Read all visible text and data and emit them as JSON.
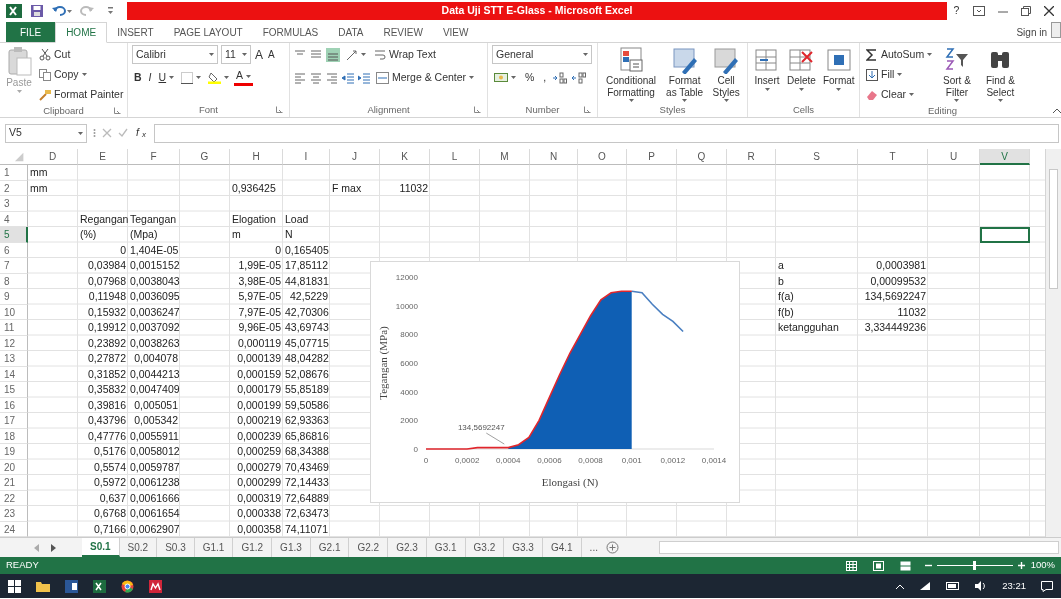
{
  "window": {
    "title": "Data Uji STT E-Glass  -  Microsoft Excel",
    "help": "?"
  },
  "ribbon_tabs": [
    {
      "label": "FILE",
      "kind": "file",
      "selected": false
    },
    {
      "label": "HOME",
      "kind": "tab",
      "selected": true
    },
    {
      "label": "INSERT",
      "kind": "tab",
      "selected": false
    },
    {
      "label": "PAGE LAYOUT",
      "kind": "tab",
      "selected": false
    },
    {
      "label": "FORMULAS",
      "kind": "tab",
      "selected": false
    },
    {
      "label": "DATA",
      "kind": "tab",
      "selected": false
    },
    {
      "label": "REVIEW",
      "kind": "tab",
      "selected": false
    },
    {
      "label": "VIEW",
      "kind": "tab",
      "selected": false
    }
  ],
  "sign_in": "Sign in",
  "ribbon": {
    "clipboard": {
      "paste": "Paste",
      "cut": "Cut",
      "copy": "Copy",
      "format_painter": "Format Painter",
      "label": "Clipboard"
    },
    "font": {
      "font_name": "Calibri",
      "font_size": "11",
      "size_buttons": [
        "A",
        "A"
      ],
      "format_buttons": [
        "B",
        "I",
        "U"
      ],
      "font_color": "A",
      "label": "Font"
    },
    "alignment": {
      "wrap_text": "Wrap Text",
      "merge_center": "Merge & Center",
      "label": "Alignment"
    },
    "number": {
      "format": "General",
      "percent": "%",
      "comma": ",",
      "label": "Number"
    },
    "styles": {
      "buttons": [
        "Conditional Formatting",
        "Format as Table",
        "Cell Styles"
      ],
      "label": "Styles"
    },
    "cells": {
      "buttons": [
        "Insert",
        "Delete",
        "Format"
      ],
      "label": "Cells"
    },
    "editing": {
      "autosum": "AutoSum",
      "fill": "Fill",
      "clear": "Clear",
      "sort_filter": "Sort & Filter",
      "find_select": "Find & Select",
      "label": "Editing"
    }
  },
  "formula_bar": {
    "name_box": "V5",
    "function_label": "f$_{x}$"
  },
  "columns": [
    {
      "label": "D",
      "selected": false
    },
    {
      "label": "E",
      "selected": false
    },
    {
      "label": "F",
      "selected": false
    },
    {
      "label": "G",
      "selected": false
    },
    {
      "label": "H",
      "selected": false
    },
    {
      "label": "I",
      "selected": false
    },
    {
      "label": "J",
      "selected": false
    },
    {
      "label": "K",
      "selected": false
    },
    {
      "label": "L",
      "selected": false
    },
    {
      "label": "M",
      "selected": false
    },
    {
      "label": "N",
      "selected": false
    },
    {
      "label": "O",
      "selected": false
    },
    {
      "label": "P",
      "selected": false
    },
    {
      "label": "Q",
      "selected": false
    },
    {
      "label": "R",
      "selected": false
    },
    {
      "label": "S",
      "selected": false
    },
    {
      "label": "T",
      "selected": false
    },
    {
      "label": "U",
      "selected": false
    },
    {
      "label": "V",
      "selected": true
    }
  ],
  "rows": [
    {
      "number": "1",
      "selected": false,
      "text": {
        "D": "mm"
      }
    },
    {
      "number": "2",
      "selected": false,
      "text": {
        "D": "mm",
        "H": "0,936425",
        "J": "F max"
      },
      "numbers": {
        "K": "11032"
      }
    },
    {
      "number": "3",
      "selected": false
    },
    {
      "number": "4",
      "selected": false,
      "text": {
        "E": "Regangan",
        "F": "Tegangan",
        "H": "Elogation",
        "I": "Load"
      }
    },
    {
      "number": "5",
      "selected": true,
      "text": {
        "E": "(%)",
        "F": "(Mpa)",
        "H": "m",
        "I": "N"
      }
    },
    {
      "number": "6",
      "selected": false,
      "numbers": {
        "E": "0",
        "F": "1,404E-05",
        "H": "0",
        "I": "0,165405"
      }
    },
    {
      "number": "7",
      "selected": false,
      "numbers": {
        "E": "0,03984",
        "F": "0,0015152",
        "H": "1,99E-05",
        "I": "17,85112",
        "T": "0,0003981"
      },
      "text": {
        "S": "a"
      }
    },
    {
      "number": "8",
      "selected": false,
      "numbers": {
        "E": "0,07968",
        "F": "0,0038043",
        "H": "3,98E-05",
        "I": "44,81831",
        "T": "0,00099532"
      },
      "text": {
        "S": "b"
      }
    },
    {
      "number": "9",
      "selected": false,
      "numbers": {
        "E": "0,11948",
        "F": "0,0036095",
        "H": "5,97E-05",
        "I": "42,5229",
        "T": "134,5692247"
      },
      "text": {
        "S": "f(a)"
      }
    },
    {
      "number": "10",
      "selected": false,
      "numbers": {
        "E": "0,15932",
        "F": "0,0036247",
        "H": "7,97E-05",
        "I": "42,70306",
        "T": "11032"
      },
      "text": {
        "S": "f(b)"
      }
    },
    {
      "number": "11",
      "selected": false,
      "numbers": {
        "E": "0,19912",
        "F": "0,0037092",
        "H": "9,96E-05",
        "I": "43,69743",
        "T": "3,334449236"
      },
      "text": {
        "S": "ketangguhan"
      }
    },
    {
      "number": "12",
      "selected": false,
      "numbers": {
        "E": "0,23892",
        "F": "0,0038263",
        "H": "0,000119",
        "I": "45,07715"
      }
    },
    {
      "number": "13",
      "selected": false,
      "numbers": {
        "E": "0,27872",
        "F": "0,004078",
        "H": "0,000139",
        "I": "48,04282"
      }
    },
    {
      "number": "14",
      "selected": false,
      "numbers": {
        "E": "0,31852",
        "F": "0,0044213",
        "H": "0,000159",
        "I": "52,08676"
      }
    },
    {
      "number": "15",
      "selected": false,
      "numbers": {
        "E": "0,35832",
        "F": "0,0047409",
        "H": "0,000179",
        "I": "55,85189"
      }
    },
    {
      "number": "16",
      "selected": false,
      "numbers": {
        "E": "0,39816",
        "F": "0,005051",
        "H": "0,000199",
        "I": "59,50586"
      }
    },
    {
      "number": "17",
      "selected": false,
      "numbers": {
        "E": "0,43796",
        "F": "0,005342",
        "H": "0,000219",
        "I": "62,93363"
      }
    },
    {
      "number": "18",
      "selected": false,
      "numbers": {
        "E": "0,47776",
        "F": "0,0055911",
        "H": "0,000239",
        "I": "65,86816"
      }
    },
    {
      "number": "19",
      "selected": false,
      "numbers": {
        "E": "0,5176",
        "F": "0,0058012",
        "H": "0,000259",
        "I": "68,34388"
      }
    },
    {
      "number": "20",
      "selected": false,
      "numbers": {
        "E": "0,5574",
        "F": "0,0059787",
        "H": "0,000279",
        "I": "70,43469"
      }
    },
    {
      "number": "21",
      "selected": false,
      "numbers": {
        "E": "0,5972",
        "F": "0,0061238",
        "H": "0,000299",
        "I": "72,14433"
      }
    },
    {
      "number": "22",
      "selected": false,
      "numbers": {
        "E": "0,637",
        "F": "0,0061666",
        "H": "0,000319",
        "I": "72,64889"
      }
    },
    {
      "number": "23",
      "selected": false,
      "numbers": {
        "E": "0,6768",
        "F": "0,0061654",
        "H": "0,000338",
        "I": "72,63473"
      }
    },
    {
      "number": "24",
      "selected": false,
      "numbers": {
        "E": "0,7166",
        "F": "0,0062907",
        "H": "0,000358",
        "I": "74,11071"
      }
    }
  ],
  "chart": {
    "chart_data": {
      "type": "line",
      "xlabel": "Elongasi (N)",
      "ylabel": "Tegangan (MPa)",
      "x": [
        0,
        5e-05,
        0.0001,
        0.00015,
        0.0002,
        0.00025,
        0.0003,
        0.00035,
        0.0004,
        0.00045,
        0.0005,
        0.00055,
        0.0006,
        0.00065,
        0.0007,
        0.00075,
        0.0008,
        0.00085,
        0.0009,
        0.00095,
        0.001,
        0.00105,
        0.0011,
        0.00115,
        0.0012,
        0.00125
      ],
      "series": [
        {
          "type": "area",
          "color": "#0f5fb4",
          "values": [
            null,
            null,
            null,
            null,
            null,
            null,
            null,
            null,
            100,
            300,
            800,
            2000,
            3600,
            5200,
            6700,
            8000,
            9300,
            10400,
            10900,
            11000,
            11000,
            null,
            null,
            null,
            null,
            null
          ]
        },
        {
          "color": "#4a7fc1",
          "values": [
            null,
            null,
            null,
            null,
            null,
            null,
            null,
            null,
            null,
            null,
            null,
            null,
            null,
            null,
            null,
            null,
            null,
            null,
            null,
            null,
            11000,
            10900,
            10100,
            9400,
            8900,
            8200
          ]
        },
        {
          "color": "#e0262c",
          "values": [
            0,
            0,
            0,
            0,
            0,
            100,
            100,
            100,
            100,
            300,
            800,
            2000,
            3600,
            5200,
            6700,
            8000,
            9300,
            10400,
            10900,
            11000,
            11000,
            null,
            null,
            null,
            null,
            null
          ]
        }
      ],
      "xlim": [
        0,
        0.0014
      ],
      "ylim": [
        0,
        12000
      ],
      "xticks": [
        {
          "value": 0,
          "label": "0"
        },
        {
          "value": 0.0002,
          "label": "0,0002"
        },
        {
          "value": 0.0004,
          "label": "0,0004"
        },
        {
          "value": 0.0006,
          "label": "0,0006"
        },
        {
          "value": 0.0008,
          "label": "0,0008"
        },
        {
          "value": 0.001,
          "label": "0,001"
        },
        {
          "value": 0.0012,
          "label": "0,0012"
        },
        {
          "value": 0.0014,
          "label": "0,0014"
        }
      ],
      "yticks": [
        {
          "value": 0,
          "label": "0"
        },
        2000,
        4000,
        6000,
        8000,
        10000,
        12000
      ],
      "annotations": [
        {
          "text": "134,5692247",
          "x": 0.0004,
          "y": 134.5692247
        }
      ]
    }
  },
  "sheet_tabs": [
    {
      "label": "S0.1",
      "selected": true
    },
    {
      "label": "S0.2",
      "selected": false
    },
    {
      "label": "S0.3",
      "selected": false
    },
    {
      "label": "G1.1",
      "selected": false
    },
    {
      "label": "G1.2",
      "selected": false
    },
    {
      "label": "G1.3",
      "selected": false
    },
    {
      "label": "G2.1",
      "selected": false
    },
    {
      "label": "G2.2",
      "selected": false
    },
    {
      "label": "G2.3",
      "selected": false
    },
    {
      "label": "G3.1",
      "selected": false
    },
    {
      "label": "G3.2",
      "selected": false
    },
    {
      "label": "G3.3",
      "selected": false
    },
    {
      "label": "G4.1",
      "selected": false
    }
  ],
  "more_sheets": "...",
  "status_bar": {
    "status": "READY",
    "zoom": "100%",
    "zoom_slider": {
      "level": 0.5
    }
  },
  "taskbar": {
    "clock": "23:21"
  }
}
